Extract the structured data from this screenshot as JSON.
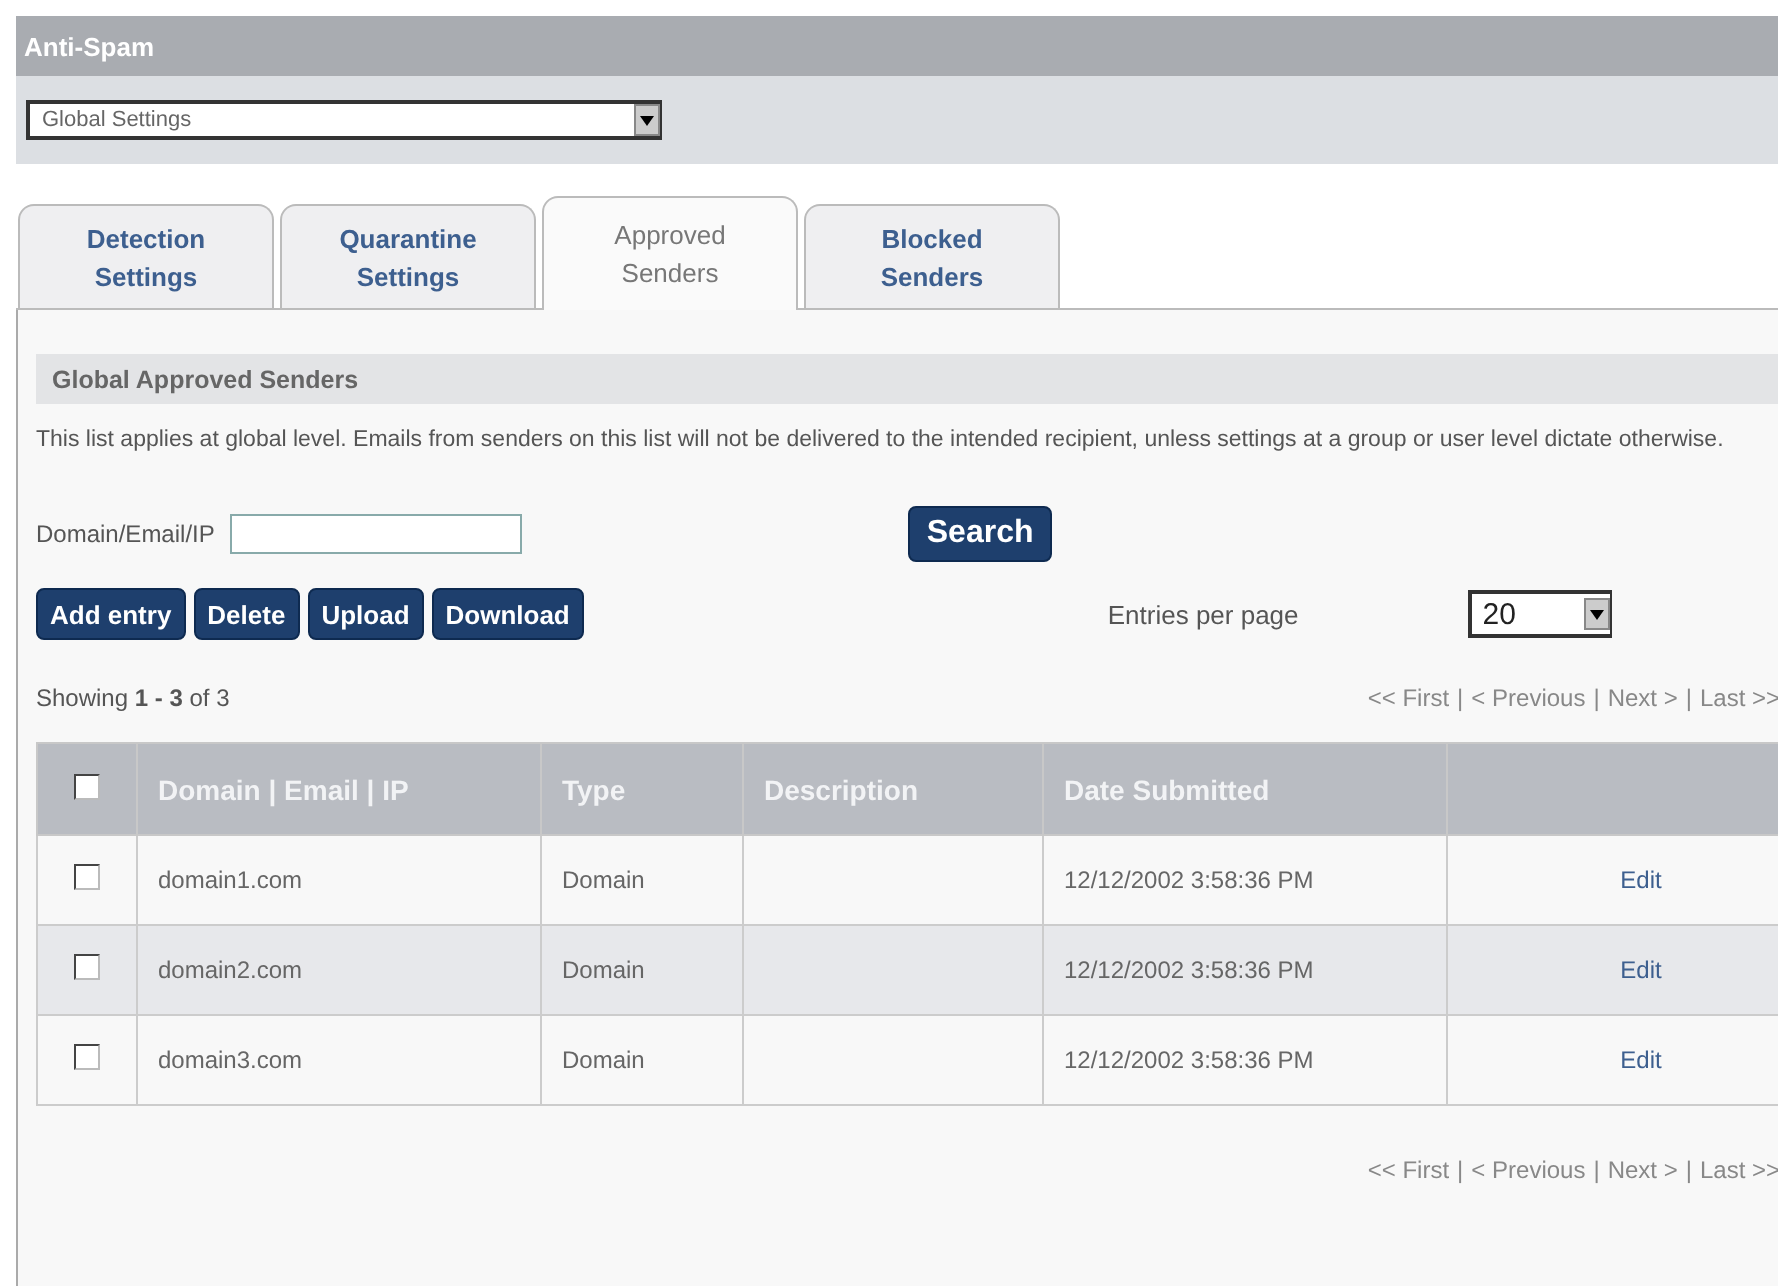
{
  "header": {
    "title": "Anti-Spam"
  },
  "scope_select": {
    "value": "Global Settings"
  },
  "tabs": [
    {
      "line1": "Detection",
      "line2": "Settings",
      "selected": false
    },
    {
      "line1": "Quarantine",
      "line2": "Settings",
      "selected": false
    },
    {
      "line1": "Approved",
      "line2": "Senders",
      "selected": true
    },
    {
      "line1": "Blocked",
      "line2": "Senders",
      "selected": false
    }
  ],
  "section": {
    "title": "Global Approved Senders",
    "description": "This list applies at global level. Emails from senders on this list will not be delivered to the intended recipient, unless settings at a group or user level dictate otherwise."
  },
  "filter": {
    "label": "Domain/Email/IP",
    "search_button": "Search"
  },
  "actions": [
    "Add entry",
    "Delete",
    "Upload",
    "Download"
  ],
  "entries_per_page": {
    "label": "Entries per page",
    "value": "20"
  },
  "showing": "Showing **1 - 3** of 3",
  "pager_top": {
    "links": [
      "<< First",
      "< Previous",
      "Next >",
      "Last >>"
    ],
    "separator": "|"
  },
  "table": {
    "select_all": false,
    "columns": [
      "Domain | Email | IP",
      "Type",
      "Description",
      "Date Submitted"
    ],
    "rows": [
      {
        "checked": false,
        "domain": "domain1.com",
        "type": "Domain",
        "date": "12/12/2002 3:58:36 PM",
        "action": "Edit"
      },
      {
        "checked": false,
        "domain": "domain2.com",
        "type": "Domain",
        "date": "12/12/2002 3:58:36 PM",
        "action": "Edit"
      },
      {
        "checked": false,
        "domain": "domain3.com",
        "type": "Domain",
        "date": "12/12/2002 3:58:36 PM",
        "action": "Edit"
      }
    ]
  },
  "pager_bottom": {
    "links": [
      "<< First",
      "< Previous",
      "Next >",
      "Last >>"
    ],
    "separator": "|"
  }
}
